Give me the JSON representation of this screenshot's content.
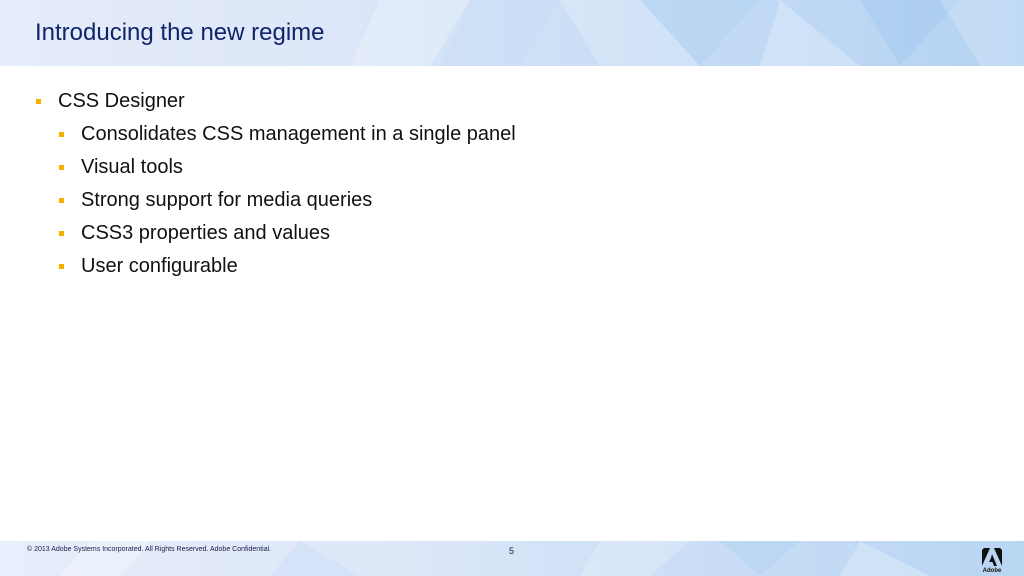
{
  "slide": {
    "title": "Introducing the new regime",
    "bullet": "CSS Designer",
    "sub_bullets": [
      "Consolidates CSS management in a single panel",
      "Visual tools",
      "Strong support for media queries",
      "CSS3 properties and values",
      "User configurable"
    ]
  },
  "footer": {
    "copyright": "© 2013 Adobe Systems Incorporated.  All Rights Reserved.  Adobe Confidential.",
    "page_number": "5",
    "logo_text": "Adobe"
  },
  "colors": {
    "bullet_marker": "#f5b000",
    "title": "#10246b"
  }
}
